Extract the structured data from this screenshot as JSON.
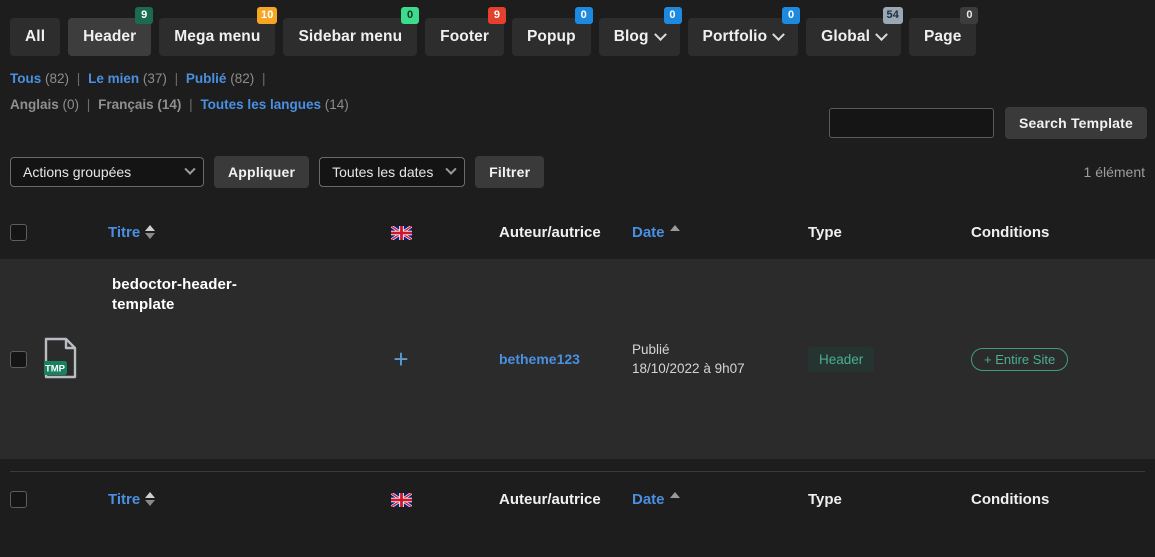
{
  "tabs": [
    {
      "label": "All",
      "badge": null,
      "badge_color": null,
      "badge_text_color": null,
      "active": false,
      "caret": false
    },
    {
      "label": "Header",
      "badge": "9",
      "badge_color": "#1b6b52",
      "badge_text_color": "#ffffff",
      "active": true,
      "caret": false
    },
    {
      "label": "Mega menu",
      "badge": "10",
      "badge_color": "#f5a623",
      "badge_text_color": "#ffffff",
      "active": false,
      "caret": false
    },
    {
      "label": "Sidebar menu",
      "badge": "0",
      "badge_color": "#3ddc8d",
      "badge_text_color": "#0d3326",
      "active": false,
      "caret": false
    },
    {
      "label": "Footer",
      "badge": "9",
      "badge_color": "#e5402c",
      "badge_text_color": "#ffffff",
      "active": false,
      "caret": false
    },
    {
      "label": "Popup",
      "badge": "0",
      "badge_color": "#1d8ae0",
      "badge_text_color": "#ffffff",
      "active": false,
      "caret": false
    },
    {
      "label": "Blog",
      "badge": "0",
      "badge_color": "#1d8ae0",
      "badge_text_color": "#ffffff",
      "active": false,
      "caret": true
    },
    {
      "label": "Portfolio",
      "badge": "0",
      "badge_color": "#1d8ae0",
      "badge_text_color": "#ffffff",
      "active": false,
      "caret": true
    },
    {
      "label": "Global",
      "badge": "54",
      "badge_color": "#9aa7b4",
      "badge_text_color": "#21303d",
      "active": false,
      "caret": true
    },
    {
      "label": "Page",
      "badge": "0",
      "badge_color": "#3c3c3c",
      "badge_text_color": "#e8e8e8",
      "active": false,
      "caret": false
    }
  ],
  "filters": {
    "status": [
      {
        "label": "Tous",
        "count": "(82)",
        "current": true
      },
      {
        "label": "Le mien",
        "count": "(37)",
        "current": false
      },
      {
        "label": "Publié",
        "count": "(82)",
        "current": false
      }
    ],
    "languages": [
      {
        "label": "Anglais",
        "count": "(0)",
        "current": true
      },
      {
        "label": "Français",
        "count": "(14)",
        "current": true
      },
      {
        "label": "Toutes les langues",
        "count": "(14)",
        "current": false
      }
    ],
    "separator": "|"
  },
  "search": {
    "value": "",
    "placeholder": "",
    "button_label": "Search Template"
  },
  "tablenav": {
    "bulk_actions_label": "Actions groupées",
    "apply_label": "Appliquer",
    "dates_label": "Toutes les dates",
    "filter_label": "Filtrer",
    "item_count": "1 élément"
  },
  "columns": {
    "title": "Titre",
    "language_flag": "🇬🇧",
    "author": "Auteur/autrice",
    "date": "Date",
    "type": "Type",
    "conditions": "Conditions"
  },
  "row": {
    "title": "bedoctor-header-template",
    "icon_label": "TMP",
    "add_translation": "+",
    "author": "betheme123",
    "date_status": "Publié",
    "date_value": "18/10/2022 à 9h07",
    "type": "Header",
    "condition": "+ Entire Site"
  },
  "colors": {
    "page_bg": "#1d1d1d",
    "row_bg": "#2b2b2b",
    "link": "#4a90e2",
    "accent_green": "#4cae92"
  }
}
